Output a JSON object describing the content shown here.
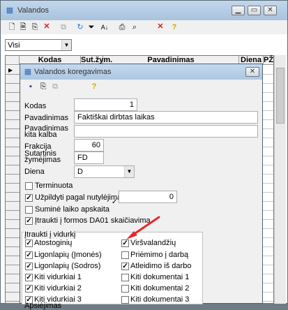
{
  "main": {
    "title": "Valandos",
    "filter": "Visi",
    "columns": [
      "Kodas",
      "Sut.žym.",
      "Pavadinimas",
      "Diena",
      "PŽ"
    ]
  },
  "dialog": {
    "title": "Valandos koregavimas",
    "fields": {
      "kodas_label": "Kodas",
      "kodas_value": "1",
      "pavadinimas_label": "Pavadinimas",
      "pavadinimas_value": "Faktiškai dirbtas laikas",
      "kita_kalba_label1": "Pavadinimas",
      "kita_kalba_label2": "kita kalba",
      "kita_kalba_value": "",
      "frakcija_label": "Frakcija",
      "frakcija_value": "60",
      "sut_label1": "Sutartinis",
      "sut_label2": "žymėjimas",
      "sut_value": "FD",
      "diena_label": "Diena",
      "diena_value": "D"
    },
    "checks": {
      "terminuota": "Terminuota",
      "uzpildyti": "Užpildyti pagal nutylėjimą",
      "uzpildyti_value": "0",
      "sumine": "Suminė laiko apskaita",
      "itraukti_da01": "Įtraukti į formos DA01 skaičiavimą"
    },
    "group": {
      "title": "Įtraukti į vidurkį",
      "left": [
        "Atostoginių",
        "Ligonlapių (Įmonės)",
        "Ligonlapių (Sodros)",
        "Kiti vidurkiai 1",
        "Kiti vidurkiai 2",
        "Kiti vidurkiai 3"
      ],
      "right": [
        "Viršvalandžių",
        "Priėmimo į darbą",
        "Atleidimo iš darbo",
        "Kiti dokumentai 1",
        "Kiti dokumentai 2",
        "Kiti dokumentai 3"
      ],
      "bottom_partial": "Apsiėjimas"
    },
    "toolbar_help": "?"
  },
  "colors": {
    "accent": "#e8282a",
    "titlebar": "#b9d1ea"
  }
}
